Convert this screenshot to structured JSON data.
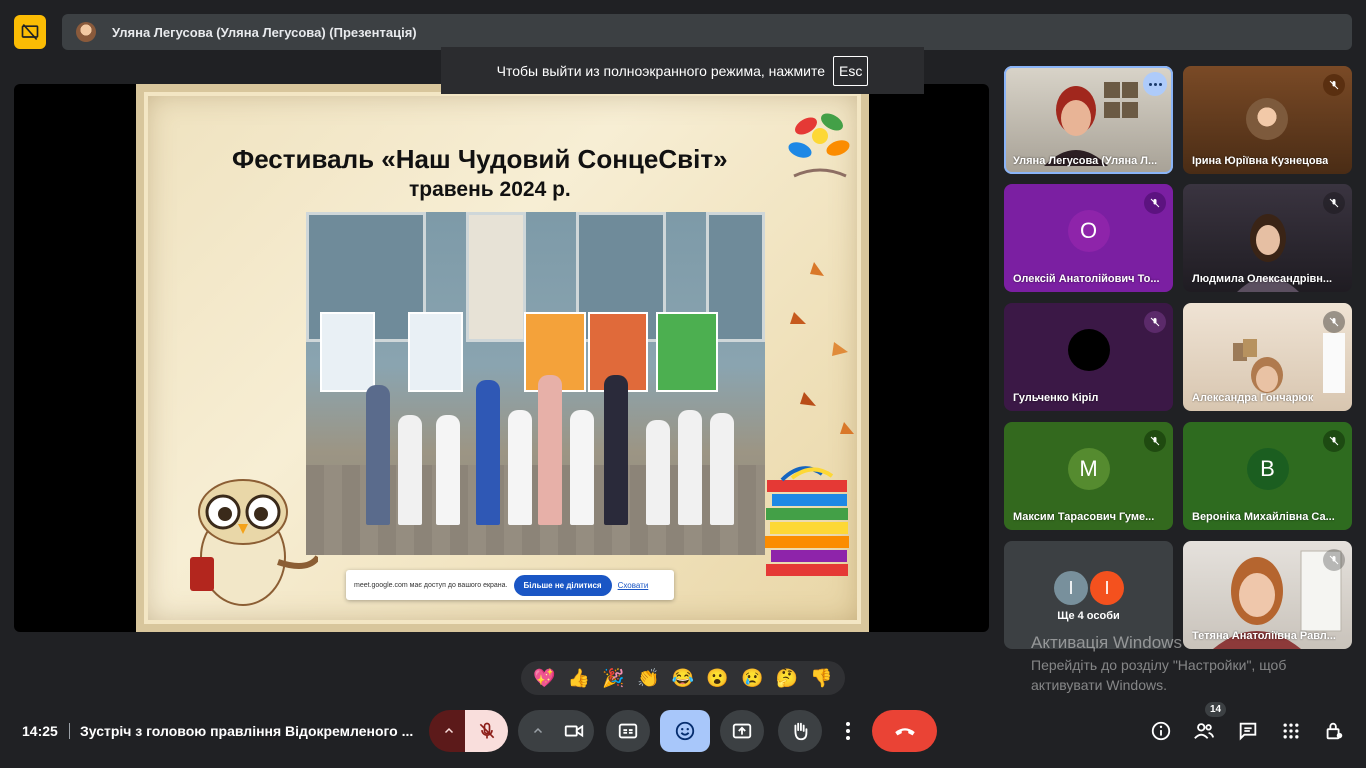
{
  "presenter_bar": {
    "name": "Уляна Легусова (Уляна Легусова) (Презентація)"
  },
  "fullscreen_toast": {
    "text": "Чтобы выйти из полноэкранного режима, нажмите",
    "key": "Esc"
  },
  "slide": {
    "title": "Фестиваль «Наш Чудовий СонцеСвіт»",
    "subtitle": "травень 2024 р."
  },
  "share_notice": {
    "text": "meet.google.com має доступ до вашого екрана.",
    "stop_label": "Більше не ділитися",
    "hide_label": "Сховати"
  },
  "participants": [
    {
      "name": "Уляна Легусова (Уляна Л...",
      "muted": false,
      "active": true
    },
    {
      "name": "Ірина Юріївна Кузнецова",
      "muted": true
    },
    {
      "name": "Олексій Анатолійович То...",
      "initial": "О",
      "muted": true,
      "color": "#7b1fa2"
    },
    {
      "name": "Людмила Олександрівн...",
      "muted": true
    },
    {
      "name": "Гульченко Кірiл",
      "muted": true,
      "color": "#3b1846"
    },
    {
      "name": "Александра Гончарюк",
      "muted": true
    },
    {
      "name": "Максим Тарасович Гуме...",
      "initial": "М",
      "muted": true,
      "color": "#33691e"
    },
    {
      "name": "Вероніка Михайлівна Са...",
      "initial": "В",
      "muted": true,
      "color": "#2e7d32"
    },
    {
      "name": "Тетяна Анатоліївна Равл...",
      "muted": true
    }
  ],
  "others_tile": {
    "label": "Ще 4 особи",
    "avatars": [
      "І",
      "І"
    ]
  },
  "windows_activation": {
    "title": "Активація Windows",
    "line1": "Перейдіть до розділу \"Настройки\", щоб",
    "line2": "активувати Windows."
  },
  "reactions": [
    "💖",
    "👍",
    "🎉",
    "👏",
    "😂",
    "😮",
    "😢",
    "🤔",
    "👎"
  ],
  "bottom_bar": {
    "time": "14:25",
    "meeting_title": "Зустріч з головою правління Відокремленого ...",
    "participants_count": "14"
  },
  "colors": {
    "accent": "#a8c7fa",
    "leave": "#ea4335",
    "mic_off": "#f9dedc",
    "top_icon": "#fbbc04"
  }
}
